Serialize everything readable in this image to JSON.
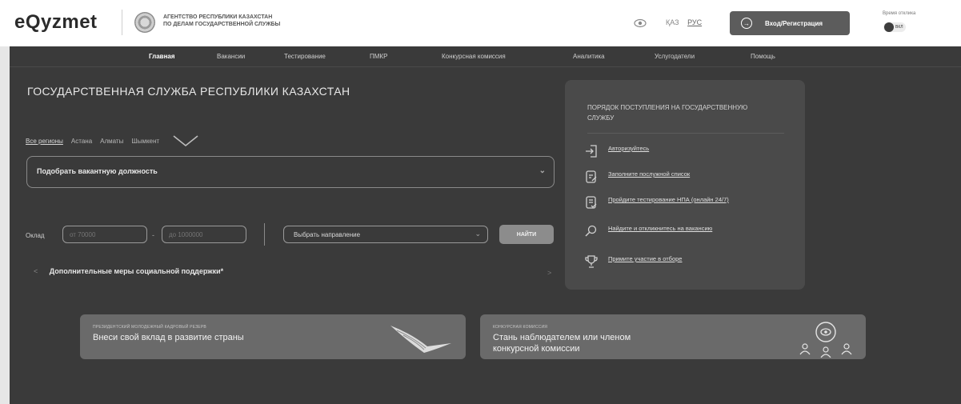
{
  "header": {
    "logo": "eQyzmet",
    "agency_line1": "АГЕНТСТВО РЕСПУБЛИКИ КАЗАХСТАН",
    "agency_line2": "ПО ДЕЛАМ ГОСУДАРСТВЕННОЙ СЛУЖБЫ",
    "lang_kz": "ҚАЗ",
    "lang_ru": "РУС",
    "login_label": "Вход/Регистрация",
    "session_label": "Время отклика",
    "session_state": "ВКЛ"
  },
  "nav": {
    "items": [
      {
        "label": "Главная"
      },
      {
        "label": "Вакансии"
      },
      {
        "label": "Тестирование"
      },
      {
        "label": "ПМКР"
      },
      {
        "label": "Конкурсная комиссия"
      },
      {
        "label": "Аналитика"
      },
      {
        "label": "Услугодатели"
      },
      {
        "label": "Помощь"
      }
    ]
  },
  "hero": {
    "title": "ГОСУДАРСТВЕННАЯ СЛУЖБА РЕСПУБЛИКИ КАЗАХСТАН",
    "regions": [
      "Все регионы",
      "Астана",
      "Алматы",
      "Шымкент"
    ],
    "vacancy_placeholder": "Подобрать вакантную должность",
    "salary_label": "Оклад",
    "salary_from_placeholder": "от 70000",
    "salary_to_placeholder": "до 1000000",
    "direction_placeholder": "Выбрать направление",
    "find_label": "НАЙТИ",
    "support_text": "Дополнительные меры социальной поддержки*"
  },
  "info": {
    "title": "ПОРЯДОК ПОСТУПЛЕНИЯ НА ГОСУДАРСТВЕННУЮ СЛУЖБУ",
    "steps": [
      {
        "label": "Авторизуйтесь",
        "icon": "login-arrow-icon"
      },
      {
        "label": "Заполните послужной список",
        "icon": "form-edit-icon"
      },
      {
        "label": "Пройдите тестирование НПА (онлайн 24/7)",
        "icon": "test-doc-icon"
      },
      {
        "label": "Найдите и откликнитесь на вакансию",
        "icon": "search-vacancy-icon"
      },
      {
        "label": "Примите участие в отборе",
        "icon": "trophy-icon"
      }
    ]
  },
  "cards": [
    {
      "small": "ПРЕЗИДЕНТСКИЙ МОЛОДЕЖНЫЙ КАДРОВЫЙ РЕЗЕРВ",
      "big": "Внеси свой вклад в развитие страны"
    },
    {
      "small": "КОНКУРСНАЯ КОМИССИЯ",
      "big_line1": "Стань наблюдателем или членом",
      "big_line2": "конкурсной комиссии"
    }
  ]
}
